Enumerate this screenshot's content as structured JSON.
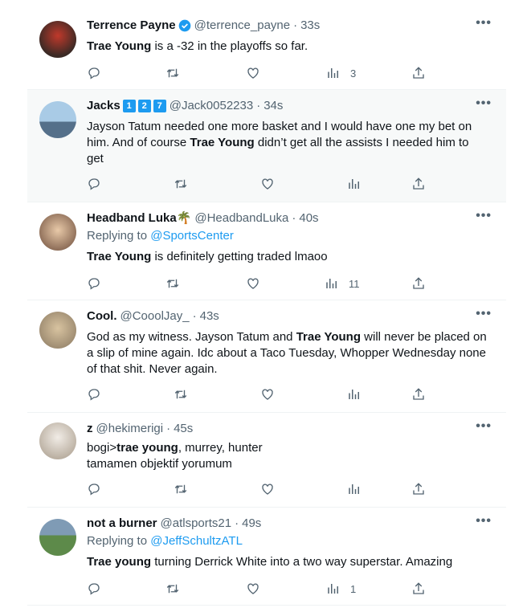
{
  "tweets": [
    {
      "name": "Terrence Payne",
      "handle": "@terrence_payne",
      "time": "33s",
      "text_pre": "",
      "text_bold": "Trae Young",
      "text_post": " is a -32 in the playoffs so far.",
      "views": "3"
    },
    {
      "name": "Jacks",
      "badges": [
        "1",
        "2",
        "7"
      ],
      "handle": "@Jack0052233",
      "time": "34s",
      "text_pre": "Jayson Tatum needed one more basket and I would have one my bet on him. And of course ",
      "text_bold": "Trae Young",
      "text_post": " didn’t get all the assists I needed him to get",
      "views": ""
    },
    {
      "name": "Headband Luka",
      "emoji": "🌴",
      "handle": "@HeadbandLuka",
      "time": "40s",
      "reply_prefix": "Replying to ",
      "reply_to": "@SportsCenter",
      "text_pre": "",
      "text_bold": "Trae Young",
      "text_post": " is definitely getting traded lmaoo",
      "views": "11"
    },
    {
      "name": "Cool.",
      "handle": "@CooolJay_",
      "time": "43s",
      "text_pre": "God as my witness. Jayson Tatum and ",
      "text_bold": "Trae Young",
      "text_post": " will never be placed on a slip of mine again. Idc about a Taco Tuesday, Whopper Wednesday none of that shit. Never again.",
      "views": ""
    },
    {
      "name": "z",
      "handle": "@hekimerigi",
      "time": "45s",
      "text_pre": "bogi>",
      "text_bold": "trae young",
      "text_post": ", murrey, hunter",
      "text_line2": "tamamen objektif yorumum",
      "views": ""
    },
    {
      "name": "not a burner",
      "handle": "@atlsports21",
      "time": "49s",
      "reply_prefix": "Replying to ",
      "reply_to": "@JeffSchultzATL",
      "text_pre": "",
      "text_bold": "Trae young",
      "text_post": " turning Derrick White into a two way superstar. Amazing",
      "views": "1"
    }
  ],
  "separator": "·",
  "more_label": "•••",
  "colors": {
    "accent": "#1d9bf0",
    "muted": "#536471",
    "highlight_bg": "#f7f9f9"
  },
  "icons": [
    "reply-icon",
    "retweet-icon",
    "like-icon",
    "views-icon",
    "share-icon",
    "more-icon",
    "verified-icon"
  ]
}
